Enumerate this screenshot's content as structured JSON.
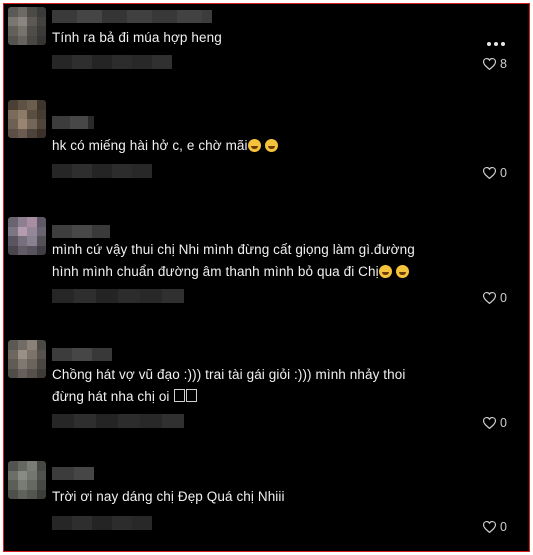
{
  "comments": [
    {
      "text": "Tính ra bả đi múa hợp heng",
      "likes": "8"
    },
    {
      "text": "hk có miếng hài hở c, e chờ mãi",
      "likes": "0"
    },
    {
      "text": "mình cứ vậy thui chị Nhi mình đừng cất giọng làm gì.đường\nhình mình chuẩn đường âm thanh mình bỏ qua đi Chị",
      "likes": "0"
    },
    {
      "text": "Chồng hát vợ vũ đạo :))) trai tài gái giỏi :))) mình nhảy thoi\nđừng hát nha chị oi",
      "likes": "0"
    },
    {
      "text": "Trời ơi nay dáng chị Đẹp Quá chị Nhiii",
      "likes": "0"
    }
  ],
  "colors": {
    "frame_border": "#d81e1e",
    "background": "#000000",
    "text": "#f1f1f1"
  },
  "icons": {
    "like": "heart-icon",
    "options": "more-dots-icon",
    "emoji": "grinning-squinting-face-emoji"
  }
}
